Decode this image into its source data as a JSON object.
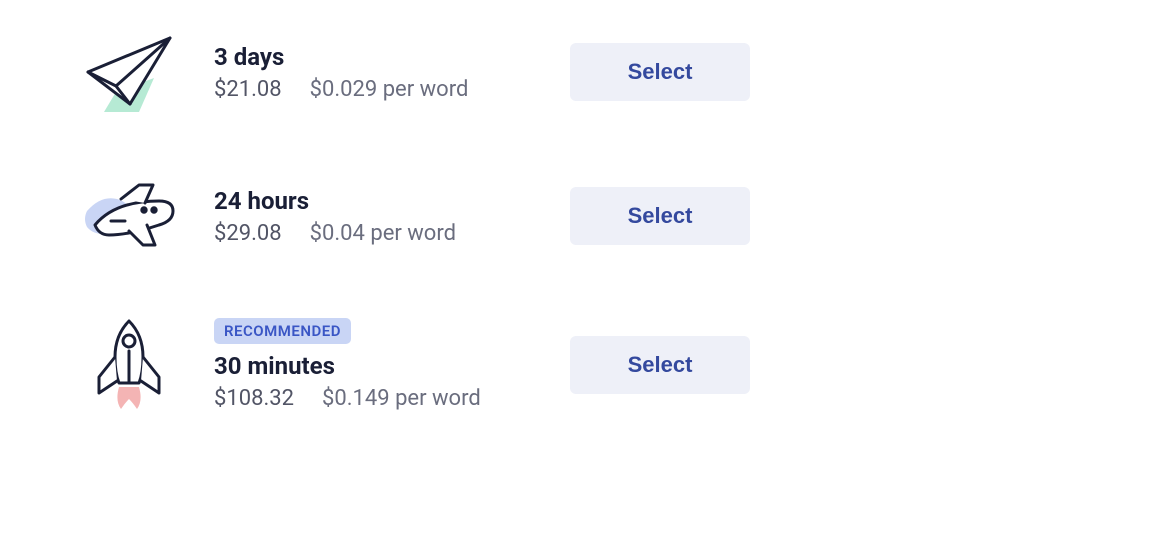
{
  "options": [
    {
      "id": "opt-3days",
      "badge": null,
      "duration": "3 days",
      "total_price": "$21.08",
      "per_word": "$0.029 per word",
      "select_label": "Select",
      "icon": "paper-airplane-icon"
    },
    {
      "id": "opt-24h",
      "badge": null,
      "duration": "24 hours",
      "total_price": "$29.08",
      "per_word": "$0.04 per word",
      "select_label": "Select",
      "icon": "airplane-icon"
    },
    {
      "id": "opt-30m",
      "badge": "RECOMMENDED",
      "duration": "30 minutes",
      "total_price": "$108.32",
      "per_word": "$0.149 per word",
      "select_label": "Select",
      "icon": "rocket-icon"
    }
  ]
}
